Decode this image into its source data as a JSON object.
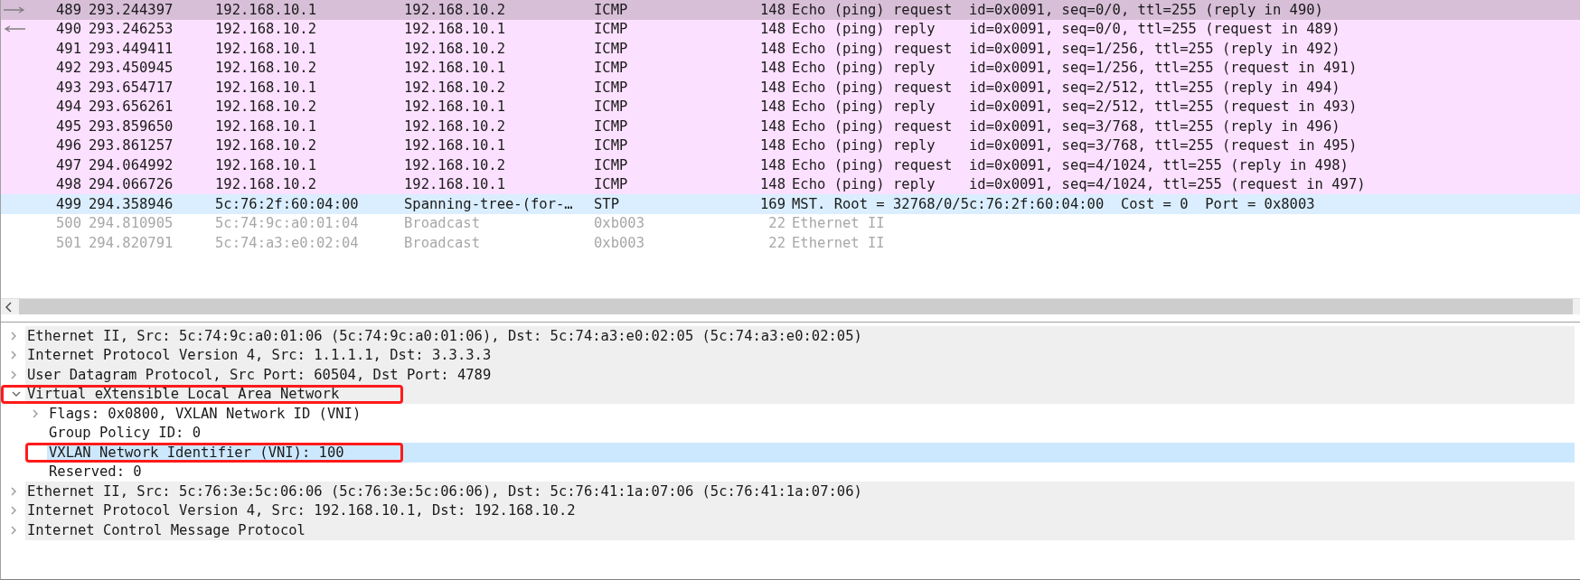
{
  "packet_list": {
    "rows": [
      {
        "no": "489",
        "time": "293.244397",
        "source": "192.168.10.1",
        "destination": "192.168.10.2",
        "protocol": "ICMP",
        "length": "148",
        "info": "Echo (ping) request  id=0x0091, seq=0/0, ttl=255 (reply in 490)",
        "color": "#d8bfd8",
        "dimmed": false,
        "kind": "request"
      },
      {
        "no": "490",
        "time": "293.246253",
        "source": "192.168.10.2",
        "destination": "192.168.10.1",
        "protocol": "ICMP",
        "length": "148",
        "info": "Echo (ping) reply    id=0x0091, seq=0/0, ttl=255 (request in 489)",
        "color": "#fce0ff",
        "dimmed": false,
        "kind": "reply"
      },
      {
        "no": "491",
        "time": "293.449411",
        "source": "192.168.10.1",
        "destination": "192.168.10.2",
        "protocol": "ICMP",
        "length": "148",
        "info": "Echo (ping) request  id=0x0091, seq=1/256, ttl=255 (reply in 492)",
        "color": "#fce0ff",
        "dimmed": false
      },
      {
        "no": "492",
        "time": "293.450945",
        "source": "192.168.10.2",
        "destination": "192.168.10.1",
        "protocol": "ICMP",
        "length": "148",
        "info": "Echo (ping) reply    id=0x0091, seq=1/256, ttl=255 (request in 491)",
        "color": "#fce0ff",
        "dimmed": false
      },
      {
        "no": "493",
        "time": "293.654717",
        "source": "192.168.10.1",
        "destination": "192.168.10.2",
        "protocol": "ICMP",
        "length": "148",
        "info": "Echo (ping) request  id=0x0091, seq=2/512, ttl=255 (reply in 494)",
        "color": "#fce0ff",
        "dimmed": false
      },
      {
        "no": "494",
        "time": "293.656261",
        "source": "192.168.10.2",
        "destination": "192.168.10.1",
        "protocol": "ICMP",
        "length": "148",
        "info": "Echo (ping) reply    id=0x0091, seq=2/512, ttl=255 (request in 493)",
        "color": "#fce0ff",
        "dimmed": false
      },
      {
        "no": "495",
        "time": "293.859650",
        "source": "192.168.10.1",
        "destination": "192.168.10.2",
        "protocol": "ICMP",
        "length": "148",
        "info": "Echo (ping) request  id=0x0091, seq=3/768, ttl=255 (reply in 496)",
        "color": "#fce0ff",
        "dimmed": false
      },
      {
        "no": "496",
        "time": "293.861257",
        "source": "192.168.10.2",
        "destination": "192.168.10.1",
        "protocol": "ICMP",
        "length": "148",
        "info": "Echo (ping) reply    id=0x0091, seq=3/768, ttl=255 (request in 495)",
        "color": "#fce0ff",
        "dimmed": false
      },
      {
        "no": "497",
        "time": "294.064992",
        "source": "192.168.10.1",
        "destination": "192.168.10.2",
        "protocol": "ICMP",
        "length": "148",
        "info": "Echo (ping) request  id=0x0091, seq=4/1024, ttl=255 (reply in 498)",
        "color": "#fce0ff",
        "dimmed": false
      },
      {
        "no": "498",
        "time": "294.066726",
        "source": "192.168.10.2",
        "destination": "192.168.10.1",
        "protocol": "ICMP",
        "length": "148",
        "info": "Echo (ping) reply    id=0x0091, seq=4/1024, ttl=255 (request in 497)",
        "color": "#fce0ff",
        "dimmed": false
      },
      {
        "no": "499",
        "time": "294.358946",
        "source": "5c:76:2f:60:04:00",
        "destination": "Spanning-tree-(for-…",
        "protocol": "STP",
        "length": "169",
        "info": "MST. Root = 32768/0/5c:76:2f:60:04:00  Cost = 0  Port = 0x8003",
        "color": "#daeeff",
        "dimmed": false
      },
      {
        "no": "500",
        "time": "294.810905",
        "source": "5c:74:9c:a0:01:04",
        "destination": "Broadcast",
        "protocol": "0xb003",
        "length": "22",
        "info": "Ethernet II",
        "color": "#ffffff",
        "dimmed": true
      },
      {
        "no": "501",
        "time": "294.820791",
        "source": "5c:74:a3:e0:02:04",
        "destination": "Broadcast",
        "protocol": "0xb003",
        "length": "22",
        "info": "Ethernet II",
        "color": "#ffffff",
        "dimmed": true
      }
    ]
  },
  "packet_details": {
    "items": [
      {
        "text": "Ethernet II, Src: 5c:74:9c:a0:01:06 (5c:74:9c:a0:01:06), Dst: 5c:74:a3:e0:02:05 (5c:74:a3:e0:02:05)",
        "kind": "branch",
        "expanded": false,
        "selected": false,
        "annotated": false
      },
      {
        "text": "Internet Protocol Version 4, Src: 1.1.1.1, Dst: 3.3.3.3",
        "kind": "branch",
        "expanded": false,
        "selected": false,
        "annotated": false
      },
      {
        "text": "User Datagram Protocol, Src Port: 60504, Dst Port: 4789",
        "kind": "branch",
        "expanded": false,
        "selected": false,
        "annotated": false
      },
      {
        "text": "Virtual eXtensible Local Area Network",
        "kind": "branch",
        "expanded": true,
        "selected": false,
        "annotated": true,
        "children": [
          {
            "text": "Flags: 0x0800, VXLAN Network ID (VNI)",
            "kind": "branch",
            "expanded": false,
            "selected": false,
            "annotated": false
          },
          {
            "text": "Group Policy ID: 0",
            "kind": "leaf",
            "selected": false,
            "annotated": false
          },
          {
            "text": "VXLAN Network Identifier (VNI): 100",
            "kind": "leaf",
            "selected": true,
            "annotated": true
          },
          {
            "text": "Reserved: 0",
            "kind": "leaf",
            "selected": false,
            "annotated": false
          }
        ]
      },
      {
        "text": "Ethernet II, Src: 5c:76:3e:5c:06:06 (5c:76:3e:5c:06:06), Dst: 5c:76:41:1a:07:06 (5c:76:41:1a:07:06)",
        "kind": "branch",
        "expanded": false,
        "selected": false,
        "annotated": false
      },
      {
        "text": "Internet Protocol Version 4, Src: 192.168.10.1, Dst: 192.168.10.2",
        "kind": "branch",
        "expanded": false,
        "selected": false,
        "annotated": false
      },
      {
        "text": "Internet Control Message Protocol",
        "kind": "branch",
        "expanded": false,
        "selected": false,
        "annotated": false
      }
    ]
  }
}
